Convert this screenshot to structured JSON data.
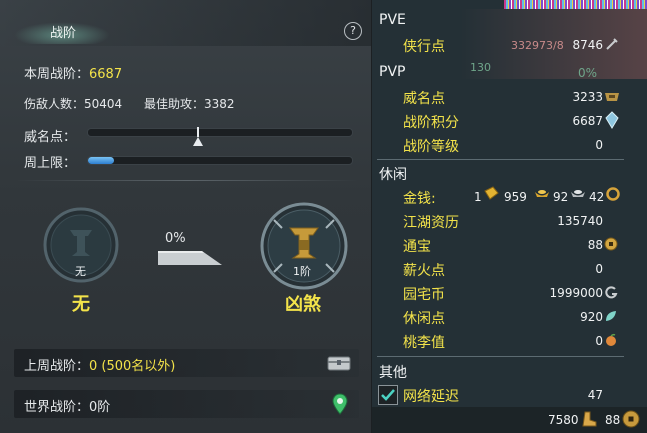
{
  "left": {
    "tab_title": "战阶",
    "help": "?",
    "weekly_label": "本周战阶：",
    "weekly_value": "6687",
    "injured_label": "伤敌人数：",
    "injured_value": "50404",
    "assist_label": "最佳助攻：",
    "assist_value": "3382",
    "prestige_label": "威名点：",
    "prestige_level": 0.42,
    "weekly_cap_label": "周上限：",
    "weekly_cap_progress": 0.1,
    "progress_percent": "0%",
    "current_rank_small": "无",
    "current_rank_name": "无",
    "next_rank_small": "1阶",
    "next_rank_name": "凶煞",
    "last_week_label": "上周战阶：",
    "last_week_value": "0 (500名以外)",
    "world_label": "世界战阶：",
    "world_value": "0阶"
  },
  "right": {
    "pve_title": "PVE",
    "pve_rows": [
      {
        "label": "侠行点",
        "value": "8746"
      }
    ],
    "pvp_title": "PVP",
    "pvp_rows": [
      {
        "label": "威名点",
        "value": "3233"
      },
      {
        "label": "战阶积分",
        "value": "6687"
      },
      {
        "label": "战阶等级",
        "value": "0"
      }
    ],
    "leisure_title": "休闲",
    "money_label": "金钱:",
    "money_gold": "1",
    "money_silver": "959",
    "money_copper": "92",
    "money_iron": "42",
    "leisure_rows": [
      {
        "label": "江湖资历",
        "value": "135740"
      },
      {
        "label": "通宝",
        "value": "88"
      },
      {
        "label": "薪火点",
        "value": "0"
      },
      {
        "label": "园宅币",
        "value": "1999000"
      },
      {
        "label": "休闲点",
        "value": "920"
      },
      {
        "label": "桃李值",
        "value": "0"
      }
    ],
    "other_title": "其他",
    "latency_label": "网络延迟",
    "latency_value": "47",
    "bottom_left_value": "7580",
    "bottom_right_value": "88",
    "bg_text_1": "332973/8",
    "bg_text_2": "130",
    "bg_text_3": "0%"
  },
  "colors": {
    "yellow": "#f3e34a",
    "blue_bar": "#3b8fde",
    "panel_dark": "#243036"
  }
}
